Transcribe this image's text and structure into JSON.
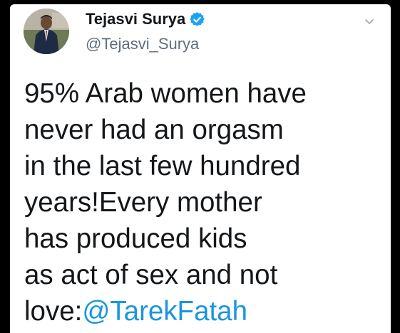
{
  "tweet": {
    "author": {
      "display_name": "Tejasvi Surya",
      "handle": "@Tejasvi_Surya",
      "verified": true,
      "avatar_icon": "profile-photo"
    },
    "menu_icon": "chevron-down-icon",
    "text_lines": [
      "95% Arab women have",
      "never had an orgasm",
      "in the last few hundred",
      "years!Every mother",
      "has produced kids",
      "as act of sex and not"
    ],
    "last_line_prefix": "love:",
    "mention": "@TarekFatah"
  },
  "colors": {
    "background": "#000000",
    "card": "#ffffff",
    "text": "#14171a",
    "handle": "#5f6e7c",
    "link": "#1b95e0",
    "verified": "#1da1f2"
  }
}
